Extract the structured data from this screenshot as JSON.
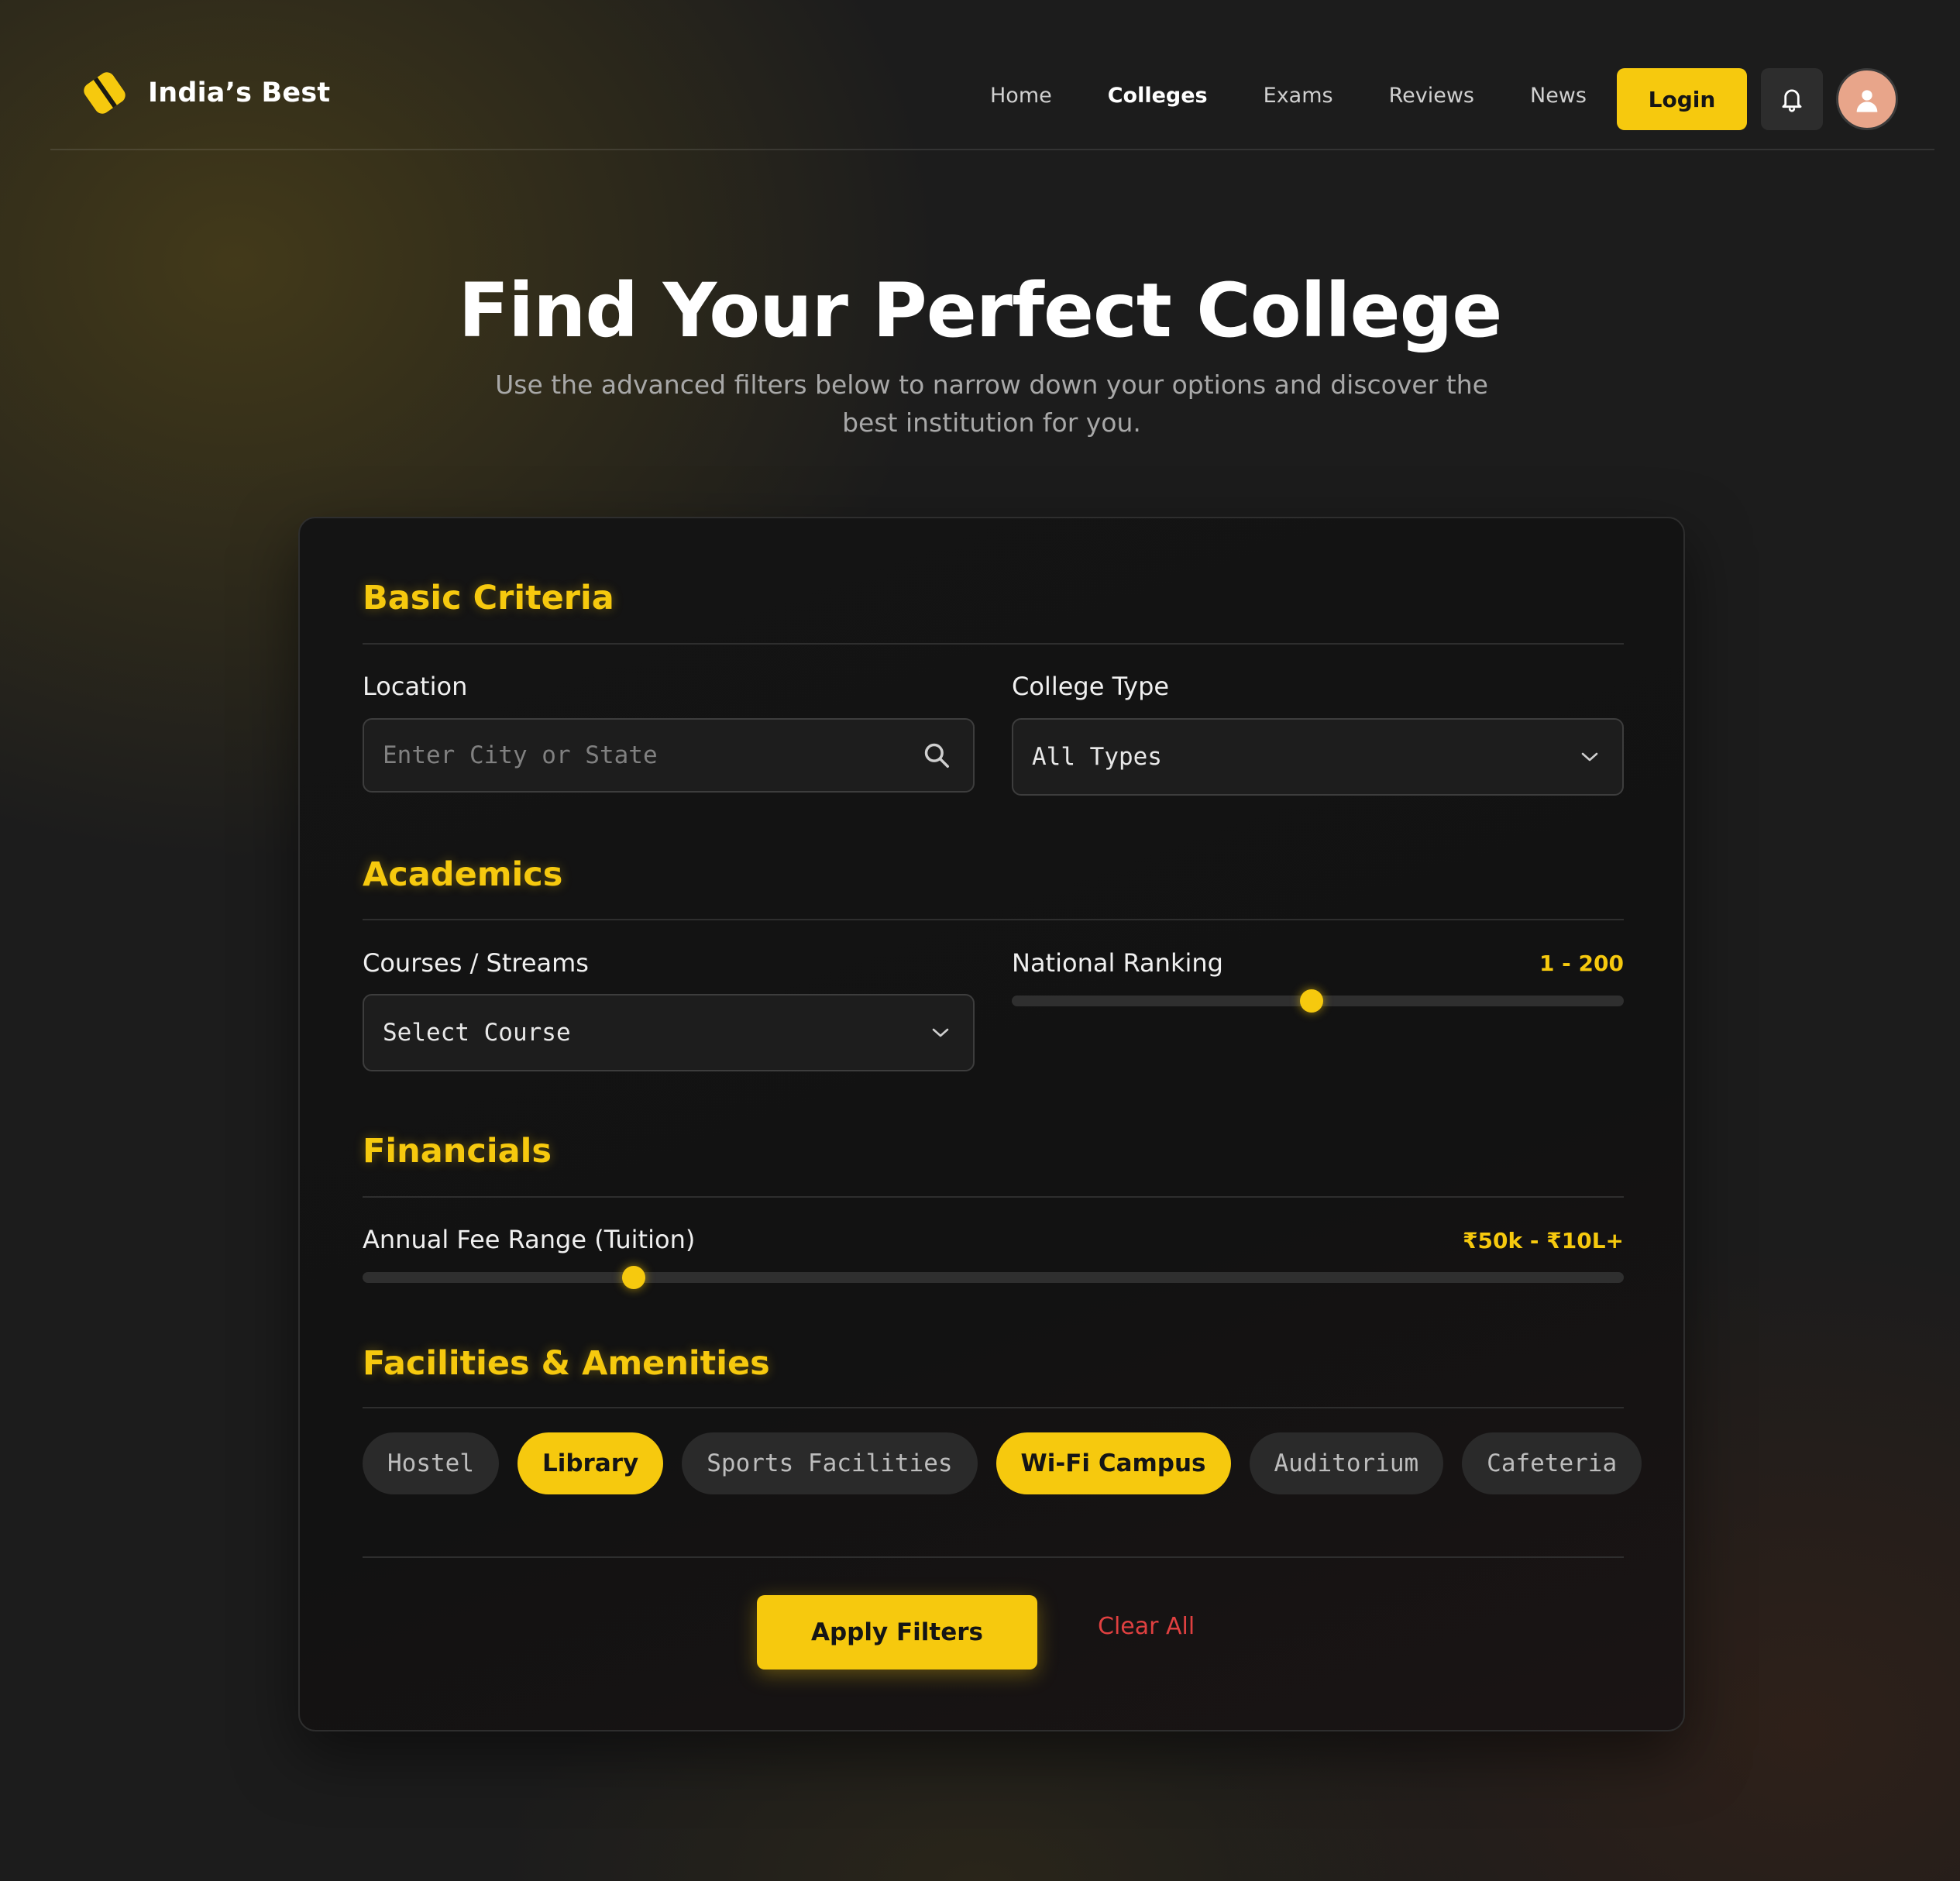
{
  "nav": {
    "brand": "India’s Best",
    "links": [
      "Home",
      "Colleges",
      "Exams",
      "Reviews",
      "News"
    ],
    "active_link": "Colleges",
    "login_label": "Login",
    "bell_icon": "bell-icon",
    "avatar_icon": "user-avatar"
  },
  "hero": {
    "title": "Find Your Perfect College",
    "subtitle": "Use the advanced filters below to narrow down your options and discover the best institution for you."
  },
  "sections": {
    "basic": {
      "title": "Basic Criteria",
      "location_label": "Location",
      "location_placeholder": "Enter City or State",
      "college_type_label": "College Type",
      "college_type_value": "All Types"
    },
    "academics": {
      "title": "Academics",
      "courses_label": "Courses / Streams",
      "courses_value": "Select Course",
      "ranking_label": "National Ranking",
      "ranking_value": "1 - 200",
      "ranking_slider_fraction": 0.49
    },
    "financials": {
      "title": "Financials",
      "fee_label": "Annual Fee Range (Tuition)",
      "fee_value": "₹50k - ₹10L+",
      "fee_slider_fraction": 0.215
    },
    "facilities": {
      "title": "Facilities & Amenities",
      "chips": [
        {
          "label": "Hostel",
          "active": false
        },
        {
          "label": "Library",
          "active": true
        },
        {
          "label": "Sports Facilities",
          "active": false
        },
        {
          "label": "Wi-Fi Campus",
          "active": true
        },
        {
          "label": "Auditorium",
          "active": false
        },
        {
          "label": "Cafeteria",
          "active": false
        }
      ]
    }
  },
  "actions": {
    "apply_label": "Apply Filters",
    "clear_label": "Clear All"
  },
  "colors": {
    "accent": "#f6c90e",
    "danger": "#e04040",
    "background": "#1c1c1c"
  }
}
